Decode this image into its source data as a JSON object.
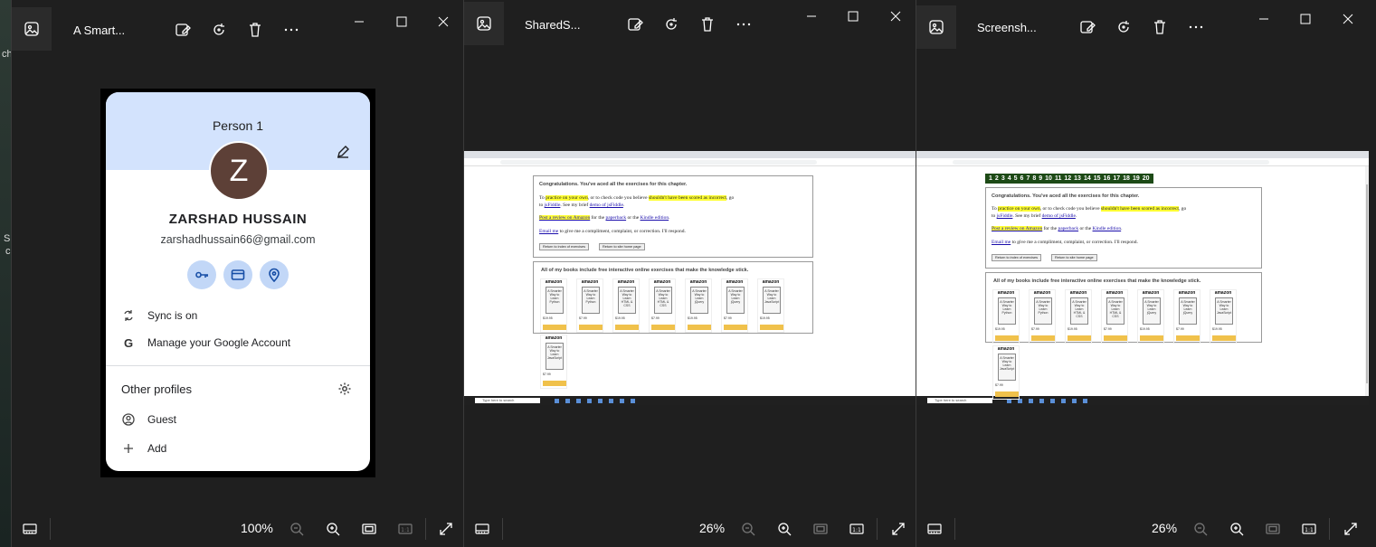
{
  "colors": {
    "window_bg": "#1f1f1f",
    "profile_header": "#d3e3fd",
    "avatar_bg": "#5d4037",
    "highlight": "#ffff33",
    "link": "#1a0dab"
  },
  "desktop": {
    "left_text": [
      "ch",
      "S",
      "c"
    ]
  },
  "windows": [
    {
      "title": "A Smart...",
      "zoom": "100%"
    },
    {
      "title": "SharedS...",
      "zoom": "26%"
    },
    {
      "title": "Screensh...",
      "zoom": "26%"
    }
  ],
  "toolbar_icons": [
    "edit-image-icon",
    "rotate-icon",
    "delete-icon",
    "more-icon"
  ],
  "window_controls": [
    "minimize-icon",
    "maximize-icon",
    "close-icon"
  ],
  "bottom_icons": [
    "filmstrip-icon",
    "zoom-out-icon",
    "zoom-in-icon",
    "fit-icon",
    "actual-size-icon",
    "fullscreen-icon"
  ],
  "profile": {
    "person_label": "Person 1",
    "avatar_letter": "Z",
    "name": "ZARSHAD HUSSAIN",
    "email": "zarshadhussain66@gmail.com",
    "quick_actions": [
      "key-icon",
      "card-icon",
      "location-icon"
    ],
    "sync": "Sync is on",
    "manage": "Manage your Google Account",
    "other_profiles": "Other profiles",
    "guest": "Guest",
    "add": "Add"
  },
  "shot": {
    "congrats": "Congratulations. You've aced all the exercises for this chapter.",
    "line1_a": "To ",
    "line1_hl1": "practice on your own",
    "line1_b": ", or to check code you believe ",
    "line1_hl2": "shouldn't have been scored as incorrect",
    "line1_c": ", go",
    "line2_a": "to ",
    "line2_link1": "jsFiddle",
    "line2_b": ". See my brief ",
    "line2_link2": "demo of jsFiddle",
    "line2_c": ".",
    "review_hl": "Post a review on Amazon",
    "review_b": " for the ",
    "review_link1": "paperback",
    "review_c": " or the ",
    "review_link2": "Kindle edition",
    "review_d": ".",
    "email_link": "Email me",
    "email_b": " to give me a compliment, complaint, or correction. I'll respond.",
    "btn_index": "Return to index of exercises",
    "btn_home": "Return to site home page",
    "books_title": "All of my books include free interactive online exercises that make the knowledge stick.",
    "amazon": "amazon",
    "book_titles": [
      "A Smarter Way to Learn Python",
      "A Smarter Way to Learn Python",
      "A Smarter Way to Learn HTML & CSS",
      "A Smarter Way to Learn HTML & CSS",
      "A Smarter Way to Learn jQuery",
      "A Smarter Way to Learn jQuery",
      "A Smarter Way to Learn JavaScript",
      "A Smarter Way to Learn JavaScript"
    ],
    "prices": [
      "$19.95",
      "$7.99",
      "$19.95",
      "$7.99",
      "$19.95",
      "$7.99",
      "$19.95",
      "$7.99"
    ],
    "taskbar_search": "Type here to search",
    "chapter_numbers": [
      "1",
      "2",
      "3",
      "4",
      "5",
      "6",
      "7",
      "8",
      "9",
      "10",
      "11",
      "12",
      "13",
      "14",
      "15",
      "16",
      "17",
      "18",
      "19",
      "20"
    ]
  }
}
